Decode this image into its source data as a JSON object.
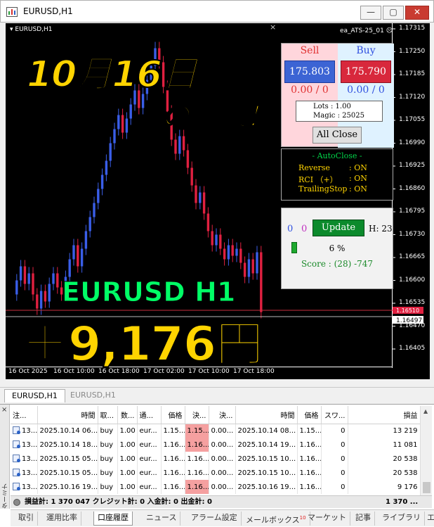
{
  "window": {
    "title": "EURUSD,H1",
    "min_label": "—",
    "max_label": "▢",
    "close_label": "✕"
  },
  "chart": {
    "symbol_label": "EURUSD,H1",
    "ea_label": "ea_ATS-25_01 ☹",
    "close_x": "×",
    "price_labels": [
      "1.17315",
      "1.17250",
      "1.17185",
      "1.17120",
      "1.17055",
      "1.16990",
      "1.16925",
      "1.16860",
      "1.16795",
      "1.16730",
      "1.16665",
      "1.16600",
      "1.16535",
      "1.16470",
      "1.16405"
    ],
    "bid_label": "1.16497",
    "ask_label": "1.16510",
    "time_labels": [
      "16 Oct 2025",
      "16 Oct 10:00",
      "16 Oct 18:00",
      "17 Oct 02:00",
      "17 Oct 10:00",
      "17 Oct 18:00"
    ],
    "colors": {
      "bull": "#3a5ee8",
      "bear": "#e02040",
      "bg": "#000000",
      "bid_line": "#c83040",
      "ask_line": "#bbbbbb"
    }
  },
  "overlay": {
    "date_text": "10月16日",
    "result_text": "の結果！",
    "symbol_text": "EURUSD H1",
    "profit_text": "＋9,176円"
  },
  "panel_trade": {
    "sell_label": "Sell",
    "buy_label": "Buy",
    "sell_price": "175.803",
    "buy_price": "175.790",
    "sell_positions": "0.00 / 0",
    "buy_positions": "0.00 / 0",
    "lots_line": "Lots   : 1.00",
    "magic_line": "Magic : 25025",
    "all_close_label": "All Close"
  },
  "panel_autoclose": {
    "title": "- AutoClose -",
    "rows": [
      {
        "label": "Reverse",
        "value": ": ON"
      },
      {
        "label": "RCI （+）",
        "value": ": ON"
      },
      {
        "label": "TrailingStop",
        "value": ": ON"
      }
    ]
  },
  "panel_score": {
    "count_a": "0",
    "count_b": "0",
    "update_label": "Update",
    "h_label": "H: 23",
    "progress_percent": 6,
    "percent_label": "6 %",
    "score_label": "Score : (28) -747"
  },
  "chart_tabs": {
    "active": "EURUSD,H1",
    "inactive": "EURUSD,H1"
  },
  "terminal": {
    "side_close": "×",
    "side_label": "ターミナル",
    "columns": [
      "注...",
      "時間",
      "取...",
      "数...",
      "通...",
      "価格",
      "決...",
      "決...",
      "時間",
      "価格",
      "スワ...",
      "損益"
    ],
    "rows": [
      [
        "13...",
        "2025.10.14 06...",
        "buy",
        "1.00",
        "eur...",
        "1.15...",
        "1.15...",
        "0.00...",
        "2025.10.14 08...",
        "1.15...",
        "0",
        "13 219"
      ],
      [
        "13...",
        "2025.10.14 18...",
        "buy",
        "1.00",
        "eur...",
        "1.16...",
        "1.16...",
        "0.00...",
        "2025.10.14 19...",
        "1.16...",
        "0",
        "11 081"
      ],
      [
        "13...",
        "2025.10.15 05...",
        "buy",
        "1.00",
        "eur...",
        "1.16...",
        "1.16...",
        "0.00...",
        "2025.10.15 10...",
        "1.16...",
        "0",
        "20 538"
      ],
      [
        "13...",
        "2025.10.15 05...",
        "buy",
        "1.00",
        "eur...",
        "1.16...",
        "1.16...",
        "0.00...",
        "2025.10.15 10...",
        "1.16...",
        "0",
        "20 538"
      ],
      [
        "13...",
        "2025.10.16 19...",
        "buy",
        "1.00",
        "eur...",
        "1.16...",
        "1.16...",
        "0.00...",
        "2025.10.16 19...",
        "1.16...",
        "0",
        "9 176"
      ]
    ],
    "summary": "損益計: 1 370 047  クレジット計: 0  入金計: 0  出金計: 0",
    "summary_right": "1 370 ...",
    "tabs": [
      "取引",
      "運用比率",
      "口座履歴",
      "ニュース",
      "アラーム設定",
      "メールボックス",
      "マーケット",
      "記事",
      "ライブラリ",
      "エキ"
    ],
    "mail_badge": "10",
    "active_tab": "口座履歴"
  }
}
